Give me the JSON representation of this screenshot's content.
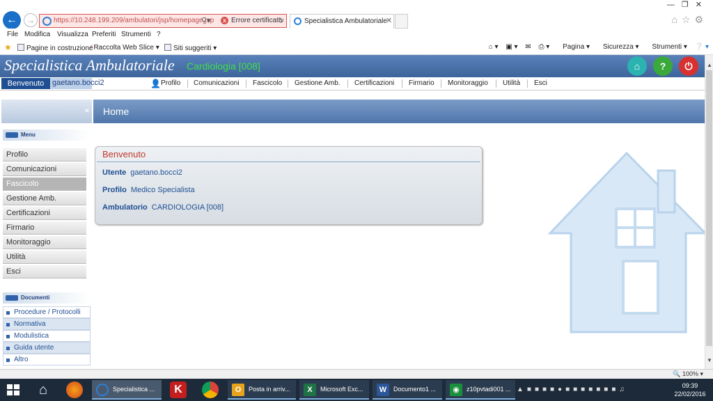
{
  "browser": {
    "url": "https://10.248.199.209/ambulatori/jsp/homepage.jsp",
    "cert_error": "Errore certificato",
    "tab_title": "Specialistica Ambulatoriale",
    "menu": [
      "File",
      "Modifica",
      "Visualizza",
      "Preferiti",
      "Strumenti",
      "?"
    ],
    "favorites": [
      "Pagine in costruzione",
      "Raccolta Web Slice",
      "Siti suggeriti"
    ],
    "tools": [
      "Pagina",
      "Sicurezza",
      "Strumenti"
    ],
    "zoom": "100%"
  },
  "app": {
    "title": "Specialistica Ambulatoriale",
    "subtitle": "Cardiologia [008]",
    "welcome_label": "Benvenuto",
    "user": "gaetano.bocci2",
    "nav": [
      "Profilo",
      "Comunicazioni",
      "Fascicolo",
      "Gestione Amb.",
      "Certificazioni",
      "Firmario",
      "Monitoraggio",
      "Utilità",
      "Esci"
    ],
    "page_title": "Home"
  },
  "sidebar": {
    "menu_label": "Menu",
    "items": [
      "Profilo",
      "Comunicazioni",
      "Fascicolo",
      "Gestione Amb.",
      "Certificazioni",
      "Firmario",
      "Monitoraggio",
      "Utilità",
      "Esci"
    ],
    "active_item": "Fascicolo",
    "docs_label": "Documenti",
    "docs": [
      "Procedure / Protocolli",
      "Normativa",
      "Modulistica",
      "Guida utente",
      "Altro"
    ]
  },
  "card": {
    "title": "Benvenuto",
    "rows": [
      {
        "key": "Utente",
        "value": "gaetano.bocci2"
      },
      {
        "key": "Profilo",
        "value": "Medico Specialista"
      },
      {
        "key": "Ambulatorio",
        "value": "CARDIOLOGIA [008]"
      }
    ]
  },
  "taskbar": {
    "tasks": [
      "Specialistica ...",
      "Posta in arriv...",
      "Microsoft Exc...",
      "Documento1 ...",
      "z10pvtadi001 ..."
    ],
    "time": "09:39",
    "date": "22/02/2016"
  },
  "colors": {
    "header_blue": "#4a6fa5",
    "subtitle_green": "#3fe04a",
    "card_title_red": "#c0392b"
  }
}
